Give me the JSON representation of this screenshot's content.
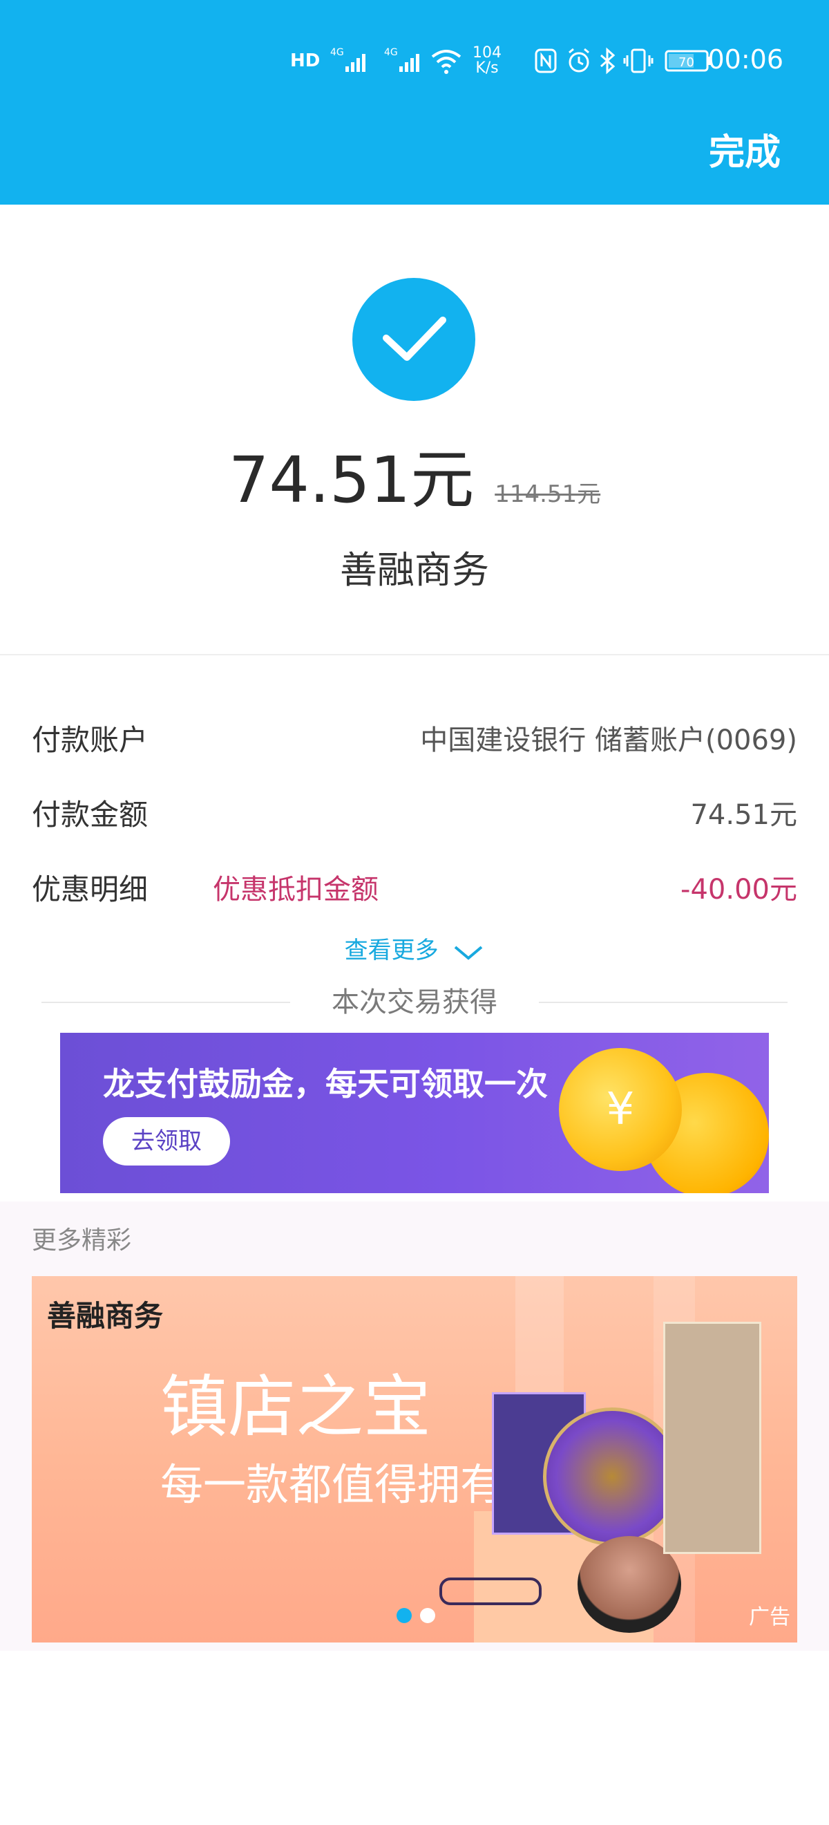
{
  "status_bar": {
    "signal_1": "HD",
    "signal_2": "4G",
    "signal_3": "4G",
    "net_speed_value": "104",
    "net_speed_unit": "K/s",
    "battery": "70",
    "time": "00:06"
  },
  "header": {
    "done_label": "完成"
  },
  "payment": {
    "amount": "74.51元",
    "original_amount": "114.51元",
    "merchant": "善融商务"
  },
  "details": [
    {
      "label": "付款账户",
      "value": "中国建设银行 储蓄账户(0069)"
    },
    {
      "label": "付款金额",
      "value": "74.51元"
    },
    {
      "label": "优惠明细",
      "sub_label": "优惠抵扣金额",
      "value": "-40.00元"
    }
  ],
  "view_more": "查看更多",
  "gain_title": "本次交易获得",
  "reward_banner": {
    "title": "龙支付鼓励金，每天可领取一次",
    "button": "去领取",
    "coin_symbol": "¥"
  },
  "more_section": {
    "title": "更多精彩",
    "ad": {
      "brand": "善融商务",
      "headline": "镇店之宝",
      "subline": "每一款都值得拥有",
      "ad_label": "广告"
    }
  },
  "colors": {
    "brand_blue": "#12b2ef",
    "discount_red": "#c6356b",
    "banner_purple": "#7b55e6",
    "coin_gold": "#ffc21a"
  }
}
